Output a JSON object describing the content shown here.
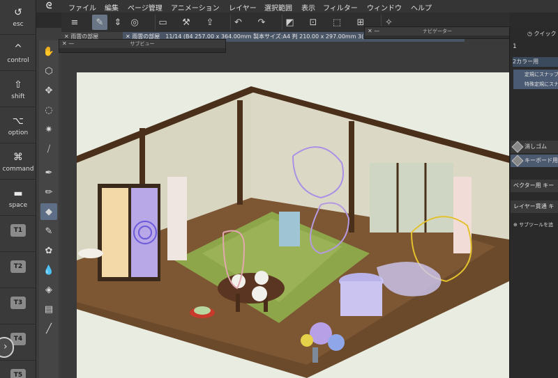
{
  "modifier_keys": [
    {
      "label": "esc",
      "glyph": "↺"
    },
    {
      "label": "control",
      "glyph": "^"
    },
    {
      "label": "shift",
      "glyph": "⇧"
    },
    {
      "label": "option",
      "glyph": "⌥"
    },
    {
      "label": "command",
      "glyph": "⌘"
    },
    {
      "label": "space",
      "glyph": "▬"
    }
  ],
  "custom_keys": [
    "T1",
    "T2",
    "T3",
    "T4",
    "T5"
  ],
  "menu": [
    "ファイル",
    "編集",
    "ページ管理",
    "アニメーション",
    "レイヤー",
    "選択範囲",
    "表示",
    "フィルター",
    "ウィンドウ",
    "ヘルプ"
  ],
  "tabs": {
    "tab1": "✕ 雨雲の部屋",
    "tab2": "✕ 雨雲の部屋　11/14 (B4 257.00 x 364.00mm 製本サイズ:A4 判 210.00 x 297.00mm 3("
  },
  "panels": {
    "subview_title": "サブビュー",
    "navigator_title": "ナビゲーター",
    "quick_access": "クイック",
    "page_number": "1",
    "color_set": "2カラー用",
    "stabilizers": [
      "定規にスナップ",
      "特殊定規にスナ"
    ],
    "subtools": [
      "消しゴム",
      "キーボード用",
      "ベクター用 キー",
      "レイヤー貫通 キ"
    ],
    "add_subtool": "サブツールを追"
  },
  "icons": {
    "app_logo": "clip-studio-logo-icon",
    "expand": "chevron-right-icon"
  },
  "colors": {
    "accent": "#5d6e86",
    "paper": "#e9ece0"
  }
}
